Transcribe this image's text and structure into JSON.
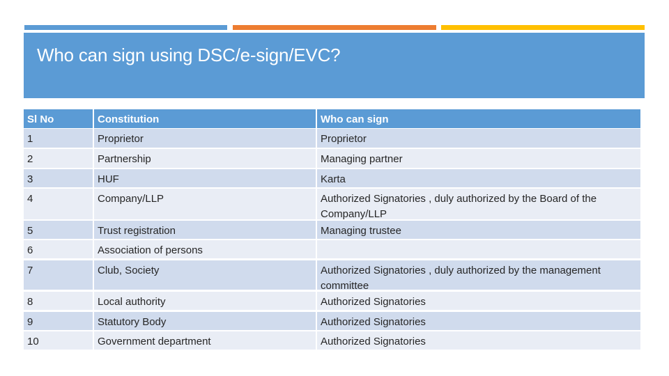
{
  "slide": {
    "title": "Who can sign using DSC/e-sign/EVC?",
    "accent_colors": [
      "#5b9bd5",
      "#ed7d31",
      "#ffc000"
    ]
  },
  "table": {
    "headers": [
      "Sl No",
      "Constitution",
      "Who can sign"
    ],
    "rows": [
      {
        "no": "1",
        "constitution": "Proprietor",
        "who": "Proprietor"
      },
      {
        "no": "2",
        "constitution": "Partnership",
        "who": "Managing partner"
      },
      {
        "no": "3",
        "constitution": "HUF",
        "who": "Karta"
      },
      {
        "no": "4",
        "constitution": "Company/LLP",
        "who": "Authorized Signatories , duly authorized by the Board of the Company/LLP"
      },
      {
        "no": "5",
        "constitution": "Trust registration",
        "who": "Managing trustee"
      },
      {
        "no": "6",
        "constitution": "Association of persons",
        "who": ""
      },
      {
        "no": "7",
        "constitution": "Club, Society",
        "who": "Authorized Signatories , duly authorized by the management committee"
      },
      {
        "no": "8",
        "constitution": "Local authority",
        "who": "Authorized Signatories"
      },
      {
        "no": "9",
        "constitution": "Statutory Body",
        "who": "Authorized Signatories"
      },
      {
        "no": "10",
        "constitution": "Government department",
        "who": "Authorized Signatories"
      }
    ]
  }
}
